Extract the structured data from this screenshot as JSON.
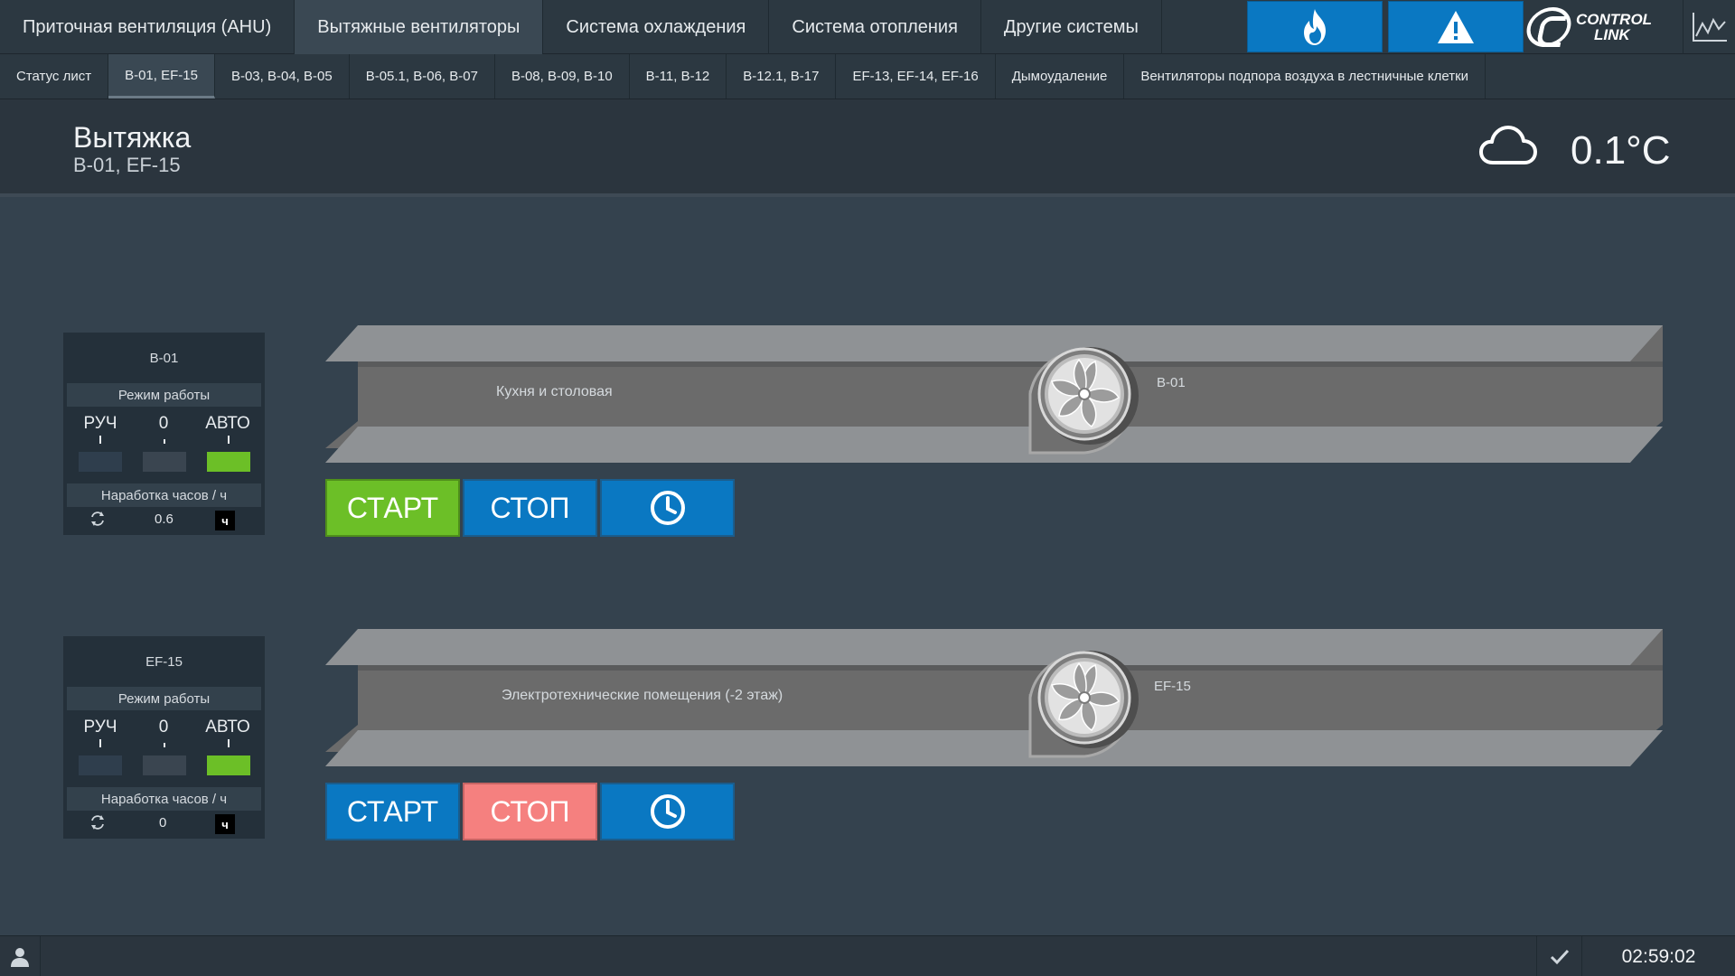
{
  "main_tabs": [
    {
      "label": "Приточная вентиляция (AHU)"
    },
    {
      "label": "Вытяжные вентиляторы"
    },
    {
      "label": "Система охлаждения"
    },
    {
      "label": "Система отопления"
    },
    {
      "label": "Другие системы"
    }
  ],
  "logo": {
    "line1": "CONTROL",
    "line2": "LINK"
  },
  "sub_tabs": [
    {
      "label": "Статус лист"
    },
    {
      "label": "B-01, EF-15"
    },
    {
      "label": "B-03, B-04, B-05"
    },
    {
      "label": "B-05.1, B-06, B-07"
    },
    {
      "label": "B-08, B-09, B-10"
    },
    {
      "label": "B-11, B-12"
    },
    {
      "label": "B-12.1, B-17"
    },
    {
      "label": "EF-13, EF-14, EF-16"
    },
    {
      "label": "Дымоудаление"
    },
    {
      "label": "Вентиляторы подпора воздуха в лестничные клетки"
    }
  ],
  "header": {
    "title": "Вытяжка",
    "subtitle": "B-01, EF-15",
    "temperature": "0.1°C"
  },
  "units": [
    {
      "name": "B-01",
      "mode_label": "Режим работы",
      "modes": [
        "РУЧ",
        "0",
        "АВТО"
      ],
      "active_mode": 2,
      "hours_label": "Наработка часов / ч",
      "hours_value": "0.6",
      "hours_unit": "ч",
      "duct_label": "Кухня и столовая",
      "fan_tag": "B-01",
      "start_label": "СТАРТ",
      "stop_label": "СТОП",
      "running": true
    },
    {
      "name": "EF-15",
      "mode_label": "Режим работы",
      "modes": [
        "РУЧ",
        "0",
        "АВТО"
      ],
      "active_mode": 2,
      "hours_label": "Наработка часов / ч",
      "hours_value": "0",
      "hours_unit": "ч",
      "duct_label": "Электротехнические помещения (-2 этаж)",
      "fan_tag": "EF-15",
      "start_label": "СТАРТ",
      "stop_label": "СТОП",
      "running": false
    }
  ],
  "footer": {
    "clock": "02:59:02"
  },
  "colors": {
    "accent_blue": "#0a78c2",
    "run_green": "#6cbf27",
    "stop_red": "#f5807f",
    "auto_indicator": "#6cbf27"
  }
}
